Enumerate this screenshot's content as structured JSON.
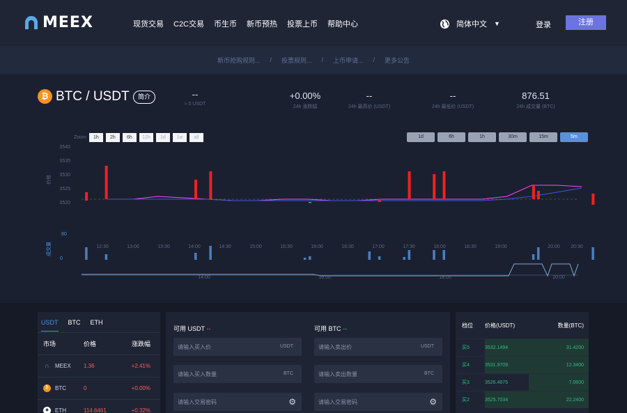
{
  "brand": {
    "name": "MEEX"
  },
  "nav": [
    "现货交易",
    "C2C交易",
    "币生币",
    "新币预热",
    "投票上币",
    "帮助中心"
  ],
  "header": {
    "language": "简体中文",
    "login": "登录",
    "register": "注册"
  },
  "notices": [
    "新币抢购规则...",
    "投票规则...",
    "上币申请...",
    "更多公告"
  ],
  "ticker": {
    "coin_symbol": "₿",
    "pair": "BTC / USDT",
    "intro": "简介",
    "last_price": "--",
    "last_price_sub": "≈ 0 USDT",
    "change": "+0.00%",
    "change_label": "24h 涨跌幅",
    "high": "--",
    "high_label": "24h 最高价 (USDT)",
    "low": "--",
    "low_label": "24h 最低价 (USDT)",
    "volume": "876.51",
    "volume_label": "24h 成交量 (BTC)"
  },
  "chart_controls": {
    "zoom_label": "Zoom",
    "zoom": [
      "1h",
      "2h",
      "6h",
      "12h",
      "1d",
      "1w",
      "all"
    ],
    "periods": [
      "1d",
      "6h",
      "1h",
      "30m",
      "15m",
      "5m"
    ],
    "active_period": "5m"
  },
  "chart_data": {
    "type": "line",
    "price_axis_label": "价格",
    "volume_axis_label": "成交量",
    "y_ticks": [
      3540,
      3535,
      3530,
      3525,
      3520
    ],
    "ylim": [
      3515,
      3540
    ],
    "volume_ticks": [
      80,
      0
    ],
    "x_ticks": [
      "12:30",
      "13:00",
      "13:30",
      "14:00",
      "14:30",
      "15:00",
      "15:30",
      "16:00",
      "16:30",
      "17:00",
      "17:30",
      "18:00",
      "18:30",
      "19:00",
      "20:00",
      "20:30"
    ],
    "navigator_ticks": [
      "14:00",
      "16:00",
      "18:00",
      "20:00"
    ],
    "candles": [
      {
        "t": "12:20",
        "open": 3520.5,
        "close": 3523.5,
        "dir": "down"
      },
      {
        "t": "12:40",
        "open": 3521,
        "close": 3533,
        "dir": "down"
      },
      {
        "t": "14:10",
        "open": 3521,
        "close": 3528,
        "dir": "down"
      },
      {
        "t": "14:25",
        "open": 3521,
        "close": 3531,
        "dir": "down"
      },
      {
        "t": "16:05",
        "open": 3520,
        "close": 3520,
        "dir": "up"
      },
      {
        "t": "17:15",
        "open": 3520,
        "close": 3521,
        "dir": "down"
      },
      {
        "t": "17:45",
        "open": 3521,
        "close": 3531,
        "dir": "down"
      },
      {
        "t": "18:10",
        "open": 3521,
        "close": 3530,
        "dir": "down"
      },
      {
        "t": "18:20",
        "open": 3521,
        "close": 3531,
        "dir": "down"
      },
      {
        "t": "19:50",
        "open": 3521,
        "close": 3526,
        "dir": "down"
      },
      {
        "t": "19:55",
        "open": 3521,
        "close": 3524,
        "dir": "down"
      },
      {
        "t": "20:50",
        "open": 3519,
        "close": 3523,
        "dir": "down"
      }
    ],
    "ma_series": [
      {
        "name": "MA5",
        "color": "#ff44ff",
        "values": [
          3521,
          3521,
          3522,
          3521.5,
          3521,
          3520.5,
          3520.5,
          3521,
          3521,
          3520.5,
          3520.5,
          3521,
          3521,
          3521,
          3521,
          3521,
          3522,
          3526,
          3526,
          3525.5
        ]
      },
      {
        "name": "MA10",
        "color": "#4455dd",
        "values": [
          3521,
          3521,
          3521,
          3521,
          3521,
          3520.5,
          3520.5,
          3520.5,
          3520.5,
          3520.5,
          3520.5,
          3520.5,
          3520.5,
          3520.5,
          3520.5,
          3520.5,
          3521,
          3522,
          3523.5,
          3525
        ]
      }
    ],
    "volumes": [
      {
        "t": "12:20",
        "v": 18
      },
      {
        "t": "12:40",
        "v": 8
      },
      {
        "t": "14:10",
        "v": 10
      },
      {
        "t": "14:25",
        "v": 20
      },
      {
        "t": "16:00",
        "v": 3
      },
      {
        "t": "16:05",
        "v": 5
      },
      {
        "t": "17:05",
        "v": 12
      },
      {
        "t": "17:15",
        "v": 5
      },
      {
        "t": "17:40",
        "v": 4
      },
      {
        "t": "17:45",
        "v": 14
      },
      {
        "t": "18:10",
        "v": 14
      },
      {
        "t": "18:20",
        "v": 14
      },
      {
        "t": "19:50",
        "v": 8
      },
      {
        "t": "19:55",
        "v": 18
      },
      {
        "t": "20:50",
        "v": 18
      }
    ]
  },
  "market": {
    "tabs": [
      "USDT",
      "BTC",
      "ETH"
    ],
    "active_tab": "USDT",
    "headers": [
      "市场",
      "价格",
      "涨跌幅"
    ],
    "rows": [
      {
        "icon": "meex-icon",
        "name": "MEEX",
        "price": "1.36",
        "change": "+2.41%"
      },
      {
        "icon": "bitcoin-icon",
        "name": "BTC",
        "price": "0",
        "change": "+0.00%"
      },
      {
        "icon": "ethereum-icon",
        "name": "ETH",
        "price": "114.6461",
        "change": "+0.32%"
      }
    ]
  },
  "trade": {
    "buy": {
      "available_label": "可用 USDT",
      "available_value": "--",
      "price_placeholder": "请输入买入价",
      "price_unit": "USDT",
      "amount_placeholder": "请输入买入数量",
      "amount_unit": "BTC",
      "password_placeholder": "请输入交易密码"
    },
    "sell": {
      "available_label": "可用 BTC",
      "available_value": "--",
      "price_placeholder": "请输入卖出价",
      "price_unit": "USDT",
      "amount_placeholder": "请输入卖出数量",
      "amount_unit": "BTC",
      "password_placeholder": "请输入交易密码"
    }
  },
  "orderbook": {
    "headers": [
      "档位",
      "价格(USDT)",
      "数量(BTC)"
    ],
    "rows": [
      {
        "level": "买5",
        "price": "3532.1494",
        "qty": "31.4200",
        "depth": 0.78
      },
      {
        "level": "买4",
        "price": "3531.9709",
        "qty": "12.3400",
        "depth": 0.78
      },
      {
        "level": "买3",
        "price": "3526.4675",
        "qty": "7.0600",
        "depth": 0.45
      },
      {
        "level": "买2",
        "price": "3525.7034",
        "qty": "22.2400",
        "depth": 0.78
      }
    ]
  },
  "colors": {
    "accent": "#6b73e0",
    "up": "#2ebd85",
    "down": "#ff5b5b",
    "link": "#4a90e2"
  }
}
